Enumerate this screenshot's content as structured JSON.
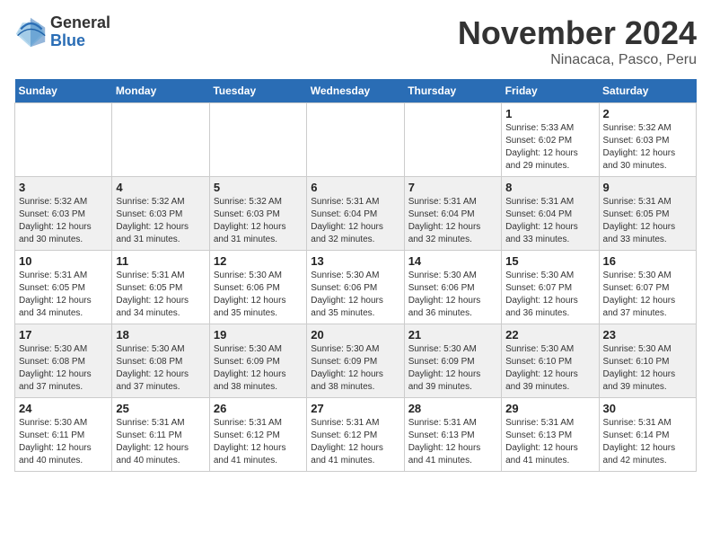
{
  "header": {
    "logo_general": "General",
    "logo_blue": "Blue",
    "month": "November 2024",
    "location": "Ninacaca, Pasco, Peru"
  },
  "weekdays": [
    "Sunday",
    "Monday",
    "Tuesday",
    "Wednesday",
    "Thursday",
    "Friday",
    "Saturday"
  ],
  "weeks": [
    [
      {
        "day": "",
        "info": ""
      },
      {
        "day": "",
        "info": ""
      },
      {
        "day": "",
        "info": ""
      },
      {
        "day": "",
        "info": ""
      },
      {
        "day": "",
        "info": ""
      },
      {
        "day": "1",
        "info": "Sunrise: 5:33 AM\nSunset: 6:02 PM\nDaylight: 12 hours and 29 minutes."
      },
      {
        "day": "2",
        "info": "Sunrise: 5:32 AM\nSunset: 6:03 PM\nDaylight: 12 hours and 30 minutes."
      }
    ],
    [
      {
        "day": "3",
        "info": "Sunrise: 5:32 AM\nSunset: 6:03 PM\nDaylight: 12 hours and 30 minutes."
      },
      {
        "day": "4",
        "info": "Sunrise: 5:32 AM\nSunset: 6:03 PM\nDaylight: 12 hours and 31 minutes."
      },
      {
        "day": "5",
        "info": "Sunrise: 5:32 AM\nSunset: 6:03 PM\nDaylight: 12 hours and 31 minutes."
      },
      {
        "day": "6",
        "info": "Sunrise: 5:31 AM\nSunset: 6:04 PM\nDaylight: 12 hours and 32 minutes."
      },
      {
        "day": "7",
        "info": "Sunrise: 5:31 AM\nSunset: 6:04 PM\nDaylight: 12 hours and 32 minutes."
      },
      {
        "day": "8",
        "info": "Sunrise: 5:31 AM\nSunset: 6:04 PM\nDaylight: 12 hours and 33 minutes."
      },
      {
        "day": "9",
        "info": "Sunrise: 5:31 AM\nSunset: 6:05 PM\nDaylight: 12 hours and 33 minutes."
      }
    ],
    [
      {
        "day": "10",
        "info": "Sunrise: 5:31 AM\nSunset: 6:05 PM\nDaylight: 12 hours and 34 minutes."
      },
      {
        "day": "11",
        "info": "Sunrise: 5:31 AM\nSunset: 6:05 PM\nDaylight: 12 hours and 34 minutes."
      },
      {
        "day": "12",
        "info": "Sunrise: 5:30 AM\nSunset: 6:06 PM\nDaylight: 12 hours and 35 minutes."
      },
      {
        "day": "13",
        "info": "Sunrise: 5:30 AM\nSunset: 6:06 PM\nDaylight: 12 hours and 35 minutes."
      },
      {
        "day": "14",
        "info": "Sunrise: 5:30 AM\nSunset: 6:06 PM\nDaylight: 12 hours and 36 minutes."
      },
      {
        "day": "15",
        "info": "Sunrise: 5:30 AM\nSunset: 6:07 PM\nDaylight: 12 hours and 36 minutes."
      },
      {
        "day": "16",
        "info": "Sunrise: 5:30 AM\nSunset: 6:07 PM\nDaylight: 12 hours and 37 minutes."
      }
    ],
    [
      {
        "day": "17",
        "info": "Sunrise: 5:30 AM\nSunset: 6:08 PM\nDaylight: 12 hours and 37 minutes."
      },
      {
        "day": "18",
        "info": "Sunrise: 5:30 AM\nSunset: 6:08 PM\nDaylight: 12 hours and 37 minutes."
      },
      {
        "day": "19",
        "info": "Sunrise: 5:30 AM\nSunset: 6:09 PM\nDaylight: 12 hours and 38 minutes."
      },
      {
        "day": "20",
        "info": "Sunrise: 5:30 AM\nSunset: 6:09 PM\nDaylight: 12 hours and 38 minutes."
      },
      {
        "day": "21",
        "info": "Sunrise: 5:30 AM\nSunset: 6:09 PM\nDaylight: 12 hours and 39 minutes."
      },
      {
        "day": "22",
        "info": "Sunrise: 5:30 AM\nSunset: 6:10 PM\nDaylight: 12 hours and 39 minutes."
      },
      {
        "day": "23",
        "info": "Sunrise: 5:30 AM\nSunset: 6:10 PM\nDaylight: 12 hours and 39 minutes."
      }
    ],
    [
      {
        "day": "24",
        "info": "Sunrise: 5:30 AM\nSunset: 6:11 PM\nDaylight: 12 hours and 40 minutes."
      },
      {
        "day": "25",
        "info": "Sunrise: 5:31 AM\nSunset: 6:11 PM\nDaylight: 12 hours and 40 minutes."
      },
      {
        "day": "26",
        "info": "Sunrise: 5:31 AM\nSunset: 6:12 PM\nDaylight: 12 hours and 41 minutes."
      },
      {
        "day": "27",
        "info": "Sunrise: 5:31 AM\nSunset: 6:12 PM\nDaylight: 12 hours and 41 minutes."
      },
      {
        "day": "28",
        "info": "Sunrise: 5:31 AM\nSunset: 6:13 PM\nDaylight: 12 hours and 41 minutes."
      },
      {
        "day": "29",
        "info": "Sunrise: 5:31 AM\nSunset: 6:13 PM\nDaylight: 12 hours and 41 minutes."
      },
      {
        "day": "30",
        "info": "Sunrise: 5:31 AM\nSunset: 6:14 PM\nDaylight: 12 hours and 42 minutes."
      }
    ]
  ]
}
